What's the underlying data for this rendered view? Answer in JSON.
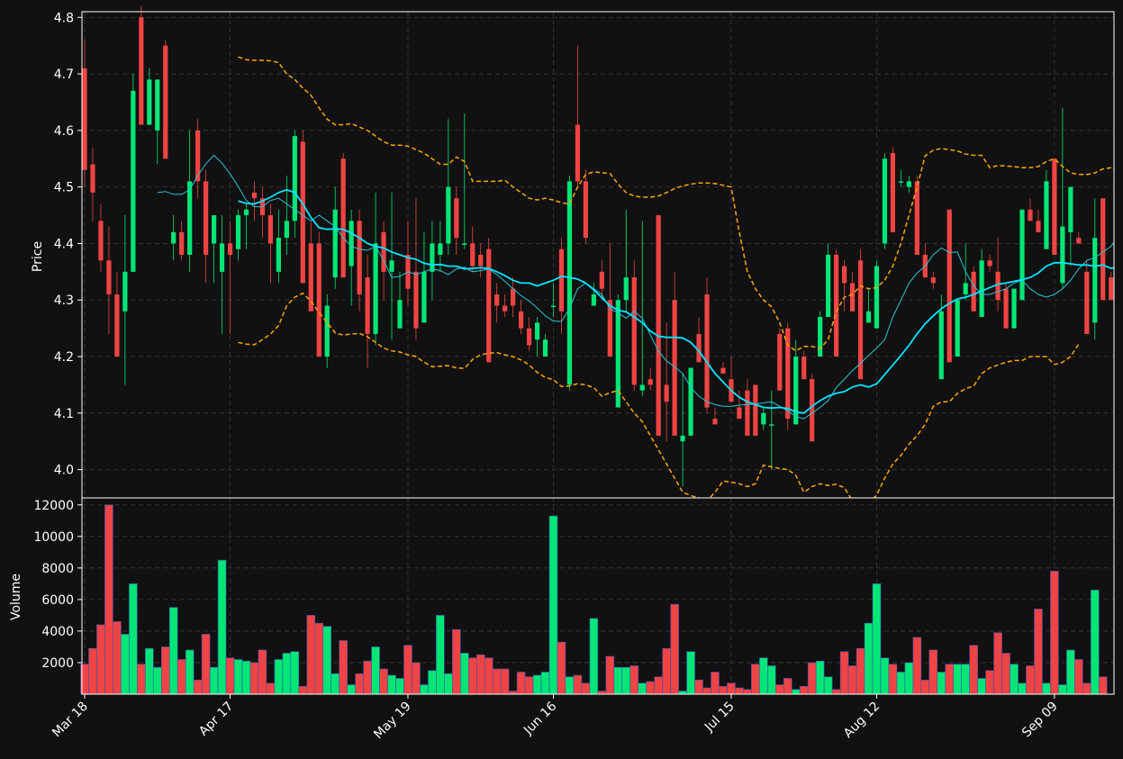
{
  "chart_data": {
    "type": "candlestick",
    "price_panel": {
      "ylabel": "Price",
      "ylim": [
        3.95,
        4.81
      ],
      "yticks": [
        "4.0",
        "4.1",
        "4.2",
        "4.3",
        "4.4",
        "4.5",
        "4.6",
        "4.7",
        "4.8"
      ],
      "grid": true
    },
    "volume_panel": {
      "ylabel": "Volume",
      "ylim": [
        0,
        12100
      ],
      "yticks": [
        "2000",
        "4000",
        "6000",
        "8000",
        "10000",
        "12000"
      ],
      "grid": true
    },
    "xaxis": {
      "tick_labels": [
        "Mar 18",
        "Apr 17",
        "May 19",
        "Jun 16",
        "Jul 15",
        "Aug 12",
        "Sep 09"
      ],
      "tick_indices": [
        0,
        18,
        40,
        58,
        80,
        98,
        120
      ]
    },
    "colors": {
      "up": "#00e676",
      "down": "#ef4444",
      "ma_fast": "#26c6da",
      "ma_slow": "#00e5ff",
      "bands": "#ffa500",
      "background": "#111111",
      "grid": "#3a3a3a"
    },
    "ohlc": [
      [
        4.71,
        4.76,
        4.5,
        4.53
      ],
      [
        4.54,
        4.57,
        4.44,
        4.49
      ],
      [
        4.44,
        4.47,
        4.35,
        4.37
      ],
      [
        4.37,
        4.43,
        4.24,
        4.31
      ],
      [
        4.31,
        4.35,
        4.2,
        4.2
      ],
      [
        4.28,
        4.45,
        4.15,
        4.35
      ],
      [
        4.35,
        4.7,
        4.35,
        4.67
      ],
      [
        4.8,
        4.82,
        4.61,
        4.61
      ],
      [
        4.61,
        4.71,
        4.61,
        4.69
      ],
      [
        4.6,
        4.69,
        4.54,
        4.69
      ],
      [
        4.75,
        4.76,
        4.55,
        4.55
      ],
      [
        4.4,
        4.45,
        4.37,
        4.42
      ],
      [
        4.42,
        4.44,
        4.37,
        4.38
      ],
      [
        4.38,
        4.6,
        4.35,
        4.51
      ],
      [
        4.6,
        4.62,
        4.48,
        4.51
      ],
      [
        4.51,
        4.53,
        4.33,
        4.38
      ],
      [
        4.4,
        4.42,
        4.33,
        4.45
      ],
      [
        4.35,
        4.45,
        4.24,
        4.4
      ],
      [
        4.4,
        4.44,
        4.24,
        4.38
      ],
      [
        4.39,
        4.46,
        4.37,
        4.45
      ],
      [
        4.45,
        4.47,
        4.39,
        4.46
      ],
      [
        4.49,
        4.51,
        4.44,
        4.48
      ],
      [
        4.48,
        4.5,
        4.41,
        4.45
      ],
      [
        4.45,
        4.47,
        4.33,
        4.4
      ],
      [
        4.35,
        4.46,
        4.33,
        4.41
      ],
      [
        4.41,
        4.52,
        4.38,
        4.44
      ],
      [
        4.44,
        4.6,
        4.41,
        4.59
      ],
      [
        4.58,
        4.6,
        4.33,
        4.33
      ],
      [
        4.4,
        4.44,
        4.28,
        4.28
      ],
      [
        4.4,
        4.42,
        4.2,
        4.2
      ],
      [
        4.2,
        4.31,
        4.18,
        4.29
      ],
      [
        4.34,
        4.5,
        4.32,
        4.46
      ],
      [
        4.55,
        4.56,
        4.34,
        4.34
      ],
      [
        4.36,
        4.46,
        4.29,
        4.44
      ],
      [
        4.44,
        4.46,
        4.28,
        4.31
      ],
      [
        4.34,
        4.38,
        4.18,
        4.24
      ],
      [
        4.24,
        4.49,
        4.22,
        4.4
      ],
      [
        4.42,
        4.44,
        4.3,
        4.35
      ],
      [
        4.35,
        4.49,
        4.23,
        4.37
      ],
      [
        4.25,
        4.35,
        4.25,
        4.3
      ],
      [
        4.38,
        4.44,
        4.29,
        4.32
      ],
      [
        4.35,
        4.48,
        4.23,
        4.25
      ],
      [
        4.26,
        4.42,
        4.26,
        4.35
      ],
      [
        4.35,
        4.44,
        4.3,
        4.4
      ],
      [
        4.38,
        4.44,
        4.35,
        4.4
      ],
      [
        4.4,
        4.62,
        4.38,
        4.5
      ],
      [
        4.48,
        4.5,
        4.38,
        4.41
      ],
      [
        4.4,
        4.63,
        4.39,
        4.4
      ],
      [
        4.4,
        4.43,
        4.35,
        4.36
      ],
      [
        4.38,
        4.4,
        4.34,
        4.36
      ],
      [
        4.39,
        4.41,
        4.19,
        4.19
      ],
      [
        4.31,
        4.33,
        4.26,
        4.29
      ],
      [
        4.29,
        4.31,
        4.27,
        4.28
      ],
      [
        4.32,
        4.34,
        4.27,
        4.29
      ],
      [
        4.28,
        4.3,
        4.24,
        4.25
      ],
      [
        4.25,
        4.27,
        4.21,
        4.22
      ],
      [
        4.23,
        4.27,
        4.2,
        4.26
      ],
      [
        4.2,
        4.24,
        4.2,
        4.23
      ],
      [
        4.29,
        4.33,
        4.27,
        4.29
      ],
      [
        4.39,
        4.41,
        4.24,
        4.28
      ],
      [
        4.15,
        4.52,
        4.14,
        4.51
      ],
      [
        4.61,
        4.75,
        4.5,
        4.51
      ],
      [
        4.51,
        4.53,
        4.4,
        4.41
      ],
      [
        4.29,
        4.33,
        4.29,
        4.31
      ],
      [
        4.35,
        4.37,
        4.3,
        4.32
      ],
      [
        4.3,
        4.4,
        4.2,
        4.2
      ],
      [
        4.11,
        4.31,
        4.11,
        4.3
      ],
      [
        4.3,
        4.46,
        4.28,
        4.34
      ],
      [
        4.34,
        4.37,
        4.14,
        4.15
      ],
      [
        4.14,
        4.44,
        4.13,
        4.15
      ],
      [
        4.16,
        4.18,
        4.14,
        4.15
      ],
      [
        4.45,
        4.45,
        4.06,
        4.06
      ],
      [
        4.15,
        4.26,
        4.05,
        4.12
      ],
      [
        4.3,
        4.35,
        4.06,
        4.06
      ],
      [
        4.05,
        4.17,
        3.97,
        4.06
      ],
      [
        4.06,
        4.18,
        4.06,
        4.18
      ],
      [
        4.24,
        4.27,
        4.19,
        4.19
      ],
      [
        4.31,
        4.34,
        4.1,
        4.11
      ],
      [
        4.09,
        4.11,
        4.08,
        4.08
      ],
      [
        4.18,
        4.19,
        4.17,
        4.17
      ],
      [
        4.16,
        4.2,
        4.12,
        4.12
      ],
      [
        4.11,
        4.14,
        4.09,
        4.09
      ],
      [
        4.14,
        4.16,
        4.06,
        4.06
      ],
      [
        4.15,
        4.15,
        4.06,
        4.06
      ],
      [
        4.08,
        4.11,
        4.07,
        4.1
      ],
      [
        4.08,
        4.14,
        4.0,
        4.08
      ],
      [
        4.24,
        4.25,
        4.14,
        4.14
      ],
      [
        4.25,
        4.26,
        4.07,
        4.09
      ],
      [
        4.08,
        4.23,
        4.08,
        4.2
      ],
      [
        4.2,
        4.21,
        4.16,
        4.16
      ],
      [
        4.16,
        4.17,
        4.05,
        4.05
      ],
      [
        4.2,
        4.28,
        4.2,
        4.27
      ],
      [
        4.27,
        4.4,
        4.27,
        4.38
      ],
      [
        4.38,
        4.39,
        4.2,
        4.2
      ],
      [
        4.36,
        4.37,
        4.28,
        4.33
      ],
      [
        4.33,
        4.35,
        4.28,
        4.28
      ],
      [
        4.37,
        4.39,
        4.16,
        4.16
      ],
      [
        4.26,
        4.32,
        4.26,
        4.28
      ],
      [
        4.25,
        4.37,
        4.25,
        4.36
      ],
      [
        4.4,
        4.56,
        4.39,
        4.55
      ],
      [
        4.56,
        4.57,
        4.42,
        4.42
      ],
      [
        4.51,
        4.53,
        4.5,
        4.51
      ],
      [
        4.5,
        4.52,
        4.49,
        4.51
      ],
      [
        4.51,
        4.52,
        4.38,
        4.38
      ],
      [
        4.38,
        4.4,
        4.34,
        4.34
      ],
      [
        4.34,
        4.35,
        4.32,
        4.33
      ],
      [
        4.16,
        4.31,
        4.16,
        4.28
      ],
      [
        4.46,
        4.46,
        4.19,
        4.19
      ],
      [
        4.2,
        4.3,
        4.2,
        4.3
      ],
      [
        4.31,
        4.4,
        4.3,
        4.33
      ],
      [
        4.35,
        4.36,
        4.28,
        4.28
      ],
      [
        4.27,
        4.39,
        4.27,
        4.37
      ],
      [
        4.37,
        4.38,
        4.35,
        4.36
      ],
      [
        4.35,
        4.41,
        4.28,
        4.3
      ],
      [
        4.32,
        4.33,
        4.25,
        4.25
      ],
      [
        4.25,
        4.32,
        4.25,
        4.32
      ],
      [
        4.3,
        4.46,
        4.3,
        4.46
      ],
      [
        4.46,
        4.48,
        4.44,
        4.44
      ],
      [
        4.44,
        4.46,
        4.42,
        4.42
      ],
      [
        4.39,
        4.53,
        4.39,
        4.51
      ],
      [
        4.55,
        4.55,
        4.38,
        4.38
      ],
      [
        4.33,
        4.64,
        4.32,
        4.43
      ],
      [
        4.42,
        4.5,
        4.36,
        4.5
      ],
      [
        4.41,
        4.42,
        4.4,
        4.4
      ],
      [
        4.35,
        4.37,
        4.24,
        4.24
      ],
      [
        4.26,
        4.48,
        4.23,
        4.41
      ],
      [
        4.48,
        4.48,
        4.3,
        4.3
      ],
      [
        4.34,
        4.35,
        4.3,
        4.3
      ]
    ],
    "volume": [
      1900,
      2900,
      4400,
      12000,
      4600,
      3800,
      7000,
      1900,
      2900,
      1700,
      3000,
      5500,
      2200,
      2800,
      900,
      3800,
      1700,
      8500,
      2300,
      2200,
      2100,
      2000,
      2800,
      700,
      2200,
      2600,
      2700,
      500,
      5000,
      4500,
      4300,
      1300,
      3400,
      600,
      1300,
      2100,
      3000,
      1600,
      1200,
      1000,
      3100,
      2000,
      600,
      1500,
      5000,
      1300,
      4100,
      2600,
      2300,
      2500,
      2300,
      1600,
      1600,
      200,
      1400,
      1100,
      1200,
      1400,
      11300,
      3300,
      1100,
      1200,
      700,
      4800,
      200,
      2400,
      1700,
      1700,
      1800,
      700,
      800,
      1100,
      2900,
      5700,
      200,
      2700,
      900,
      400,
      1400,
      500,
      700,
      400,
      300,
      1900,
      2300,
      1800,
      600,
      1000,
      300,
      500,
      2000,
      2100,
      1100,
      300,
      2700,
      1800,
      2900,
      4500,
      7000,
      2300,
      1900,
      1400,
      2000,
      3600,
      900,
      2800,
      1400,
      1900,
      1900,
      1900,
      3100,
      1000,
      1500,
      3900,
      2600,
      1900,
      700,
      1800,
      5400,
      700,
      7800,
      600,
      2800,
      2200,
      700,
      6600,
      1100
    ],
    "ma_fast": {
      "start_index": 9,
      "values": [
        4.49,
        4.492,
        4.487,
        4.487,
        4.495,
        4.52,
        4.541,
        4.556,
        4.542,
        4.523,
        4.501,
        4.476,
        4.465,
        4.465,
        4.476,
        4.48,
        4.47,
        4.46,
        4.45,
        4.44,
        4.45,
        4.44,
        4.43,
        4.41,
        4.395,
        4.39,
        4.388,
        4.395,
        4.37,
        4.34,
        4.342,
        4.35,
        4.345,
        4.35,
        4.355,
        4.352,
        4.345,
        4.355,
        4.358,
        4.35,
        4.352,
        4.355,
        4.345,
        4.333,
        4.32,
        4.308,
        4.298,
        4.286,
        4.272,
        4.263,
        4.262,
        4.285,
        4.32,
        4.33,
        4.32,
        4.31,
        4.285,
        4.277,
        4.268,
        4.28,
        4.268,
        4.238,
        4.21,
        4.192,
        4.182,
        4.17,
        4.145,
        4.13,
        4.12,
        4.115,
        4.112,
        4.112,
        4.114,
        4.115,
        4.116,
        4.118,
        4.12,
        4.112,
        4.104,
        4.094,
        4.09,
        4.1,
        4.11,
        4.122,
        4.145,
        4.16,
        4.175,
        4.188,
        4.202,
        4.215,
        4.23,
        4.27,
        4.3,
        4.33,
        4.348,
        4.36,
        4.38,
        4.392,
        4.384,
        4.385,
        4.35,
        4.325,
        4.31,
        4.31,
        4.315,
        4.32,
        4.33,
        4.335,
        4.32,
        4.31,
        4.305,
        4.31,
        4.32,
        4.335,
        4.355,
        4.37,
        4.375,
        4.385,
        4.395,
        4.415,
        4.42,
        4.414,
        4.42,
        4.41,
        4.4
      ]
    },
    "ma_slow": {
      "start_index": 19,
      "values": [
        4.475,
        4.471,
        4.47,
        4.475,
        4.482,
        4.49,
        4.495,
        4.49,
        4.47,
        4.446,
        4.428,
        4.425,
        4.426,
        4.425,
        4.418,
        4.41,
        4.4,
        4.395,
        4.392,
        4.385,
        4.38,
        4.375,
        4.372,
        4.365,
        4.362,
        4.363,
        4.36,
        4.36,
        4.355,
        4.356,
        4.357,
        4.356,
        4.35,
        4.343,
        4.335,
        4.33,
        4.33,
        4.325,
        4.33,
        4.335,
        4.342,
        4.34,
        4.337,
        4.33,
        4.318,
        4.304,
        4.29,
        4.282,
        4.279,
        4.27,
        4.26,
        4.245,
        4.236,
        4.234,
        4.234,
        4.233,
        4.225,
        4.21,
        4.19,
        4.17,
        4.155,
        4.14,
        4.128,
        4.12,
        4.115,
        4.11,
        4.109,
        4.11,
        4.108,
        4.102,
        4.1,
        4.112,
        4.122,
        4.13,
        4.135,
        4.138,
        4.146,
        4.15,
        4.146,
        4.152,
        4.168,
        4.185,
        4.202,
        4.22,
        4.24,
        4.258,
        4.272,
        4.285,
        4.294,
        4.302,
        4.305,
        4.31,
        4.316,
        4.322,
        4.328,
        4.33,
        4.333,
        4.336,
        4.34,
        4.348,
        4.36,
        4.366,
        4.366,
        4.364,
        4.362,
        4.362,
        4.36,
        4.362,
        4.356,
        4.36,
        4.366,
        4.372
      ]
    },
    "upper_band": {
      "start_index": 19,
      "values": [
        4.73,
        4.725,
        4.724,
        4.724,
        4.723,
        4.72,
        4.7,
        4.69,
        4.675,
        4.662,
        4.64,
        4.62,
        4.61,
        4.61,
        4.612,
        4.606,
        4.6,
        4.59,
        4.58,
        4.574,
        4.574,
        4.572,
        4.566,
        4.56,
        4.55,
        4.54,
        4.54,
        4.553,
        4.545,
        4.51,
        4.51,
        4.51,
        4.51,
        4.512,
        4.5,
        4.49,
        4.48,
        4.477,
        4.48,
        4.477,
        4.472,
        4.47,
        4.5,
        4.522,
        4.527,
        4.525,
        4.524,
        4.505,
        4.49,
        4.484,
        4.482,
        4.482,
        4.484,
        4.49,
        4.497,
        4.502,
        4.505,
        4.507,
        4.507,
        4.506,
        4.503,
        4.5,
        4.42,
        4.35,
        4.32,
        4.3,
        4.288,
        4.26,
        4.22,
        4.21,
        4.218,
        4.218,
        4.214,
        4.23,
        4.28,
        4.305,
        4.31,
        4.325,
        4.32,
        4.322,
        4.335,
        4.36,
        4.4,
        4.45,
        4.5,
        4.555,
        4.565,
        4.568,
        4.566,
        4.564,
        4.558,
        4.556,
        4.556,
        4.534,
        4.538,
        4.537,
        4.536,
        4.534,
        4.534,
        4.536,
        4.545,
        4.55,
        4.536,
        4.525,
        4.522,
        4.522,
        4.525,
        4.532,
        4.534,
        4.525
      ]
    },
    "lower_band": {
      "start_index": 19,
      "values": [
        4.225,
        4.222,
        4.221,
        4.23,
        4.24,
        4.255,
        4.29,
        4.305,
        4.312,
        4.298,
        4.278,
        4.26,
        4.242,
        4.238,
        4.24,
        4.241,
        4.235,
        4.225,
        4.215,
        4.21,
        4.208,
        4.203,
        4.2,
        4.19,
        4.182,
        4.183,
        4.184,
        4.18,
        4.179,
        4.195,
        4.203,
        4.206,
        4.207,
        4.203,
        4.2,
        4.194,
        4.185,
        4.172,
        4.163,
        4.159,
        4.147,
        4.148,
        4.152,
        4.15,
        4.145,
        4.13,
        4.136,
        4.14,
        4.12,
        4.1,
        4.085,
        4.06,
        4.035,
        4.01,
        3.985,
        3.96,
        3.954,
        3.95,
        3.945,
        3.96,
        3.98,
        3.978,
        3.975,
        3.97,
        3.975,
        4.008,
        4.005,
        4.002,
        4.0,
        3.99,
        3.96,
        3.97,
        3.975,
        3.972,
        3.974,
        3.968,
        3.945,
        3.92,
        3.94,
        3.955,
        3.985,
        4.01,
        4.025,
        4.045,
        4.06,
        4.08,
        4.112,
        4.12,
        4.12,
        4.135,
        4.143,
        4.148,
        4.17,
        4.18,
        4.185,
        4.19,
        4.193,
        4.193,
        4.2,
        4.2,
        4.2,
        4.186,
        4.19,
        4.2,
        4.222
      ]
    }
  }
}
